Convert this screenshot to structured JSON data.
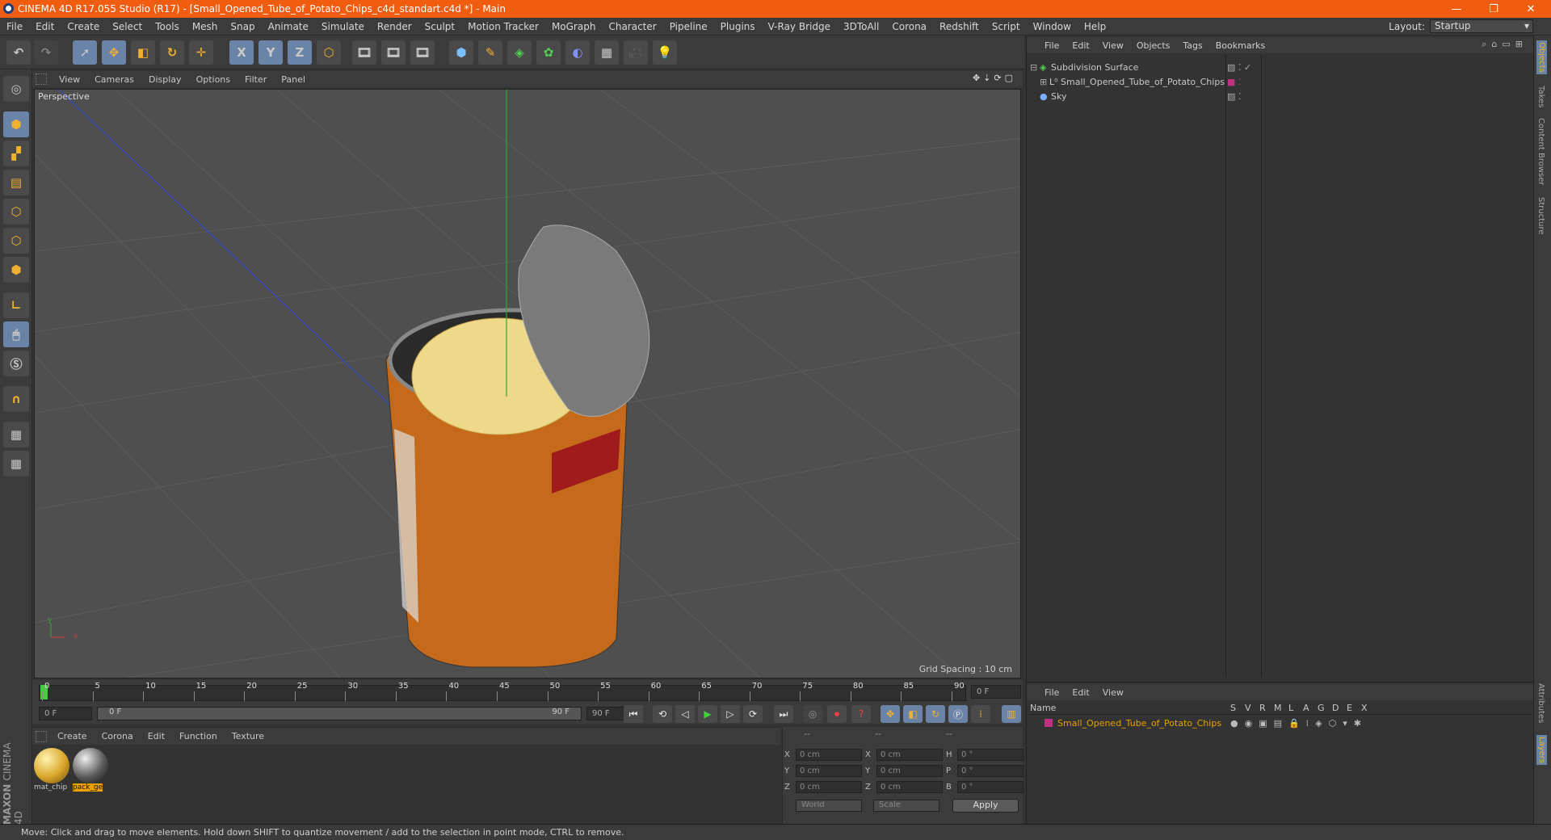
{
  "window": {
    "title": "CINEMA 4D R17.055 Studio (R17) - [Small_Opened_Tube_of_Potato_Chips_c4d_standart.c4d *] - Main",
    "minimize": "—",
    "maximize": "❐",
    "close": "✕"
  },
  "menubar": {
    "items": [
      "File",
      "Edit",
      "Create",
      "Select",
      "Tools",
      "Mesh",
      "Snap",
      "Animate",
      "Simulate",
      "Render",
      "Sculpt",
      "Motion Tracker",
      "MoGraph",
      "Character",
      "Pipeline",
      "Plugins",
      "V-Ray Bridge",
      "3DToAll",
      "Corona",
      "Redshift",
      "Script",
      "Window",
      "Help"
    ],
    "layout_label": "Layout:",
    "layout_value": "Startup"
  },
  "toolbar": {
    "axis_x": "X",
    "axis_y": "Y",
    "axis_z": "Z"
  },
  "viewport": {
    "menu": [
      "View",
      "Cameras",
      "Display",
      "Options",
      "Filter",
      "Panel"
    ],
    "label": "Perspective",
    "grid_spacing": "Grid Spacing : 10 cm",
    "axis_x": "x",
    "axis_y": "y"
  },
  "timeline": {
    "ticks": [
      "0",
      "5",
      "10",
      "15",
      "20",
      "25",
      "30",
      "35",
      "40",
      "45",
      "50",
      "55",
      "60",
      "65",
      "70",
      "75",
      "80",
      "85",
      "90"
    ],
    "current_frame": "0 F",
    "start": "0 F",
    "range_start": "0 F",
    "range_end": "90 F",
    "end": "90 F"
  },
  "material": {
    "menu": [
      "Create",
      "Corona",
      "Edit",
      "Function",
      "Texture"
    ],
    "items": [
      {
        "name": "mat_chip",
        "color": "#d9a62a"
      },
      {
        "name": "pack_ge",
        "color": "#5a5a5a"
      }
    ]
  },
  "coordinates": {
    "header": [
      "--",
      "--",
      "--"
    ],
    "rows": [
      {
        "a": "X",
        "av": "0 cm",
        "b": "X",
        "bv": "0 cm",
        "c": "H",
        "cv": "0 °"
      },
      {
        "a": "Y",
        "av": "0 cm",
        "b": "Y",
        "bv": "0 cm",
        "c": "P",
        "cv": "0 °"
      },
      {
        "a": "Z",
        "av": "0 cm",
        "b": "Z",
        "bv": "0 cm",
        "c": "B",
        "cv": "0 °"
      }
    ],
    "world": "World",
    "scale": "Scale",
    "apply": "Apply"
  },
  "objects": {
    "menu": [
      "File",
      "Edit",
      "View",
      "Objects",
      "Tags",
      "Bookmarks"
    ],
    "items": [
      {
        "name": "Subdivision Surface",
        "color": "#c8c8c8"
      },
      {
        "name": "Small_Opened_Tube_of_Potato_Chips",
        "color": "#c8c8c8"
      },
      {
        "name": "Sky",
        "color": "#c8c8c8"
      }
    ]
  },
  "layers": {
    "menu": [
      "File",
      "Edit",
      "View"
    ],
    "header_name": "Name",
    "columns": [
      "S",
      "V",
      "R",
      "M",
      "L",
      "A",
      "G",
      "D",
      "E",
      "X"
    ],
    "row": "Small_Opened_Tube_of_Potato_Chips",
    "row_color": "#e8a000"
  },
  "right_tabs": [
    "Objects",
    "Takes",
    "Content Browser",
    "Structure",
    "Attributes",
    "Layers"
  ],
  "brand": {
    "a": "MAXON",
    "b": "CINEMA 4D"
  },
  "status": "Move: Click and drag to move elements. Hold down SHIFT to quantize movement / add to the selection in point mode, CTRL to remove.",
  "colors": {
    "titlebar": "#f05d11",
    "accent_blue": "#6a84a8"
  }
}
